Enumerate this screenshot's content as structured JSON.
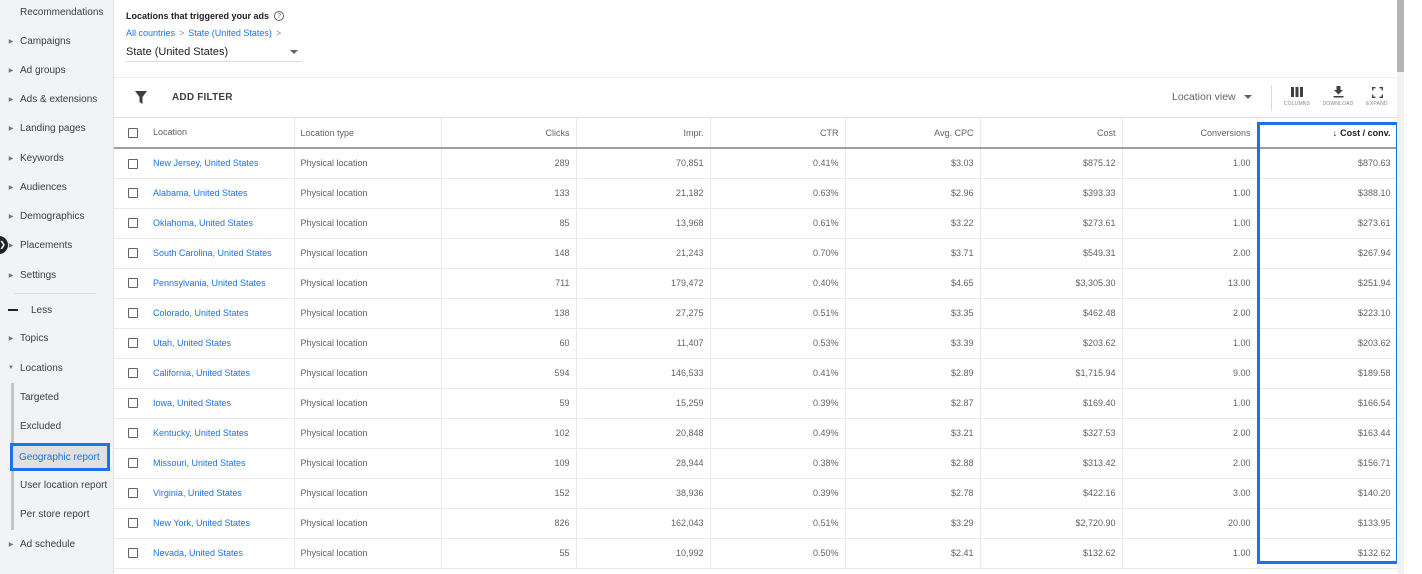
{
  "sidebar": {
    "items": [
      {
        "label": "Recommendations",
        "type": "plain"
      },
      {
        "label": "Campaigns",
        "type": "top"
      },
      {
        "label": "Ad groups",
        "type": "top"
      },
      {
        "label": "Ads & extensions",
        "type": "top"
      },
      {
        "label": "Landing pages",
        "type": "top"
      },
      {
        "label": "Keywords",
        "type": "top"
      },
      {
        "label": "Audiences",
        "type": "top"
      },
      {
        "label": "Demographics",
        "type": "top"
      },
      {
        "label": "Placements",
        "type": "top"
      },
      {
        "label": "Settings",
        "type": "top"
      }
    ],
    "less_label": "Less",
    "more_items": [
      {
        "label": "Topics"
      },
      {
        "label": "Locations"
      }
    ],
    "locations_sub": [
      {
        "label": "Targeted"
      },
      {
        "label": "Excluded"
      },
      {
        "label": "Geographic report",
        "selected": true
      },
      {
        "label": "User location report"
      },
      {
        "label": "Per store report"
      }
    ],
    "after_items": [
      {
        "label": "Ad schedule"
      }
    ]
  },
  "header": {
    "title": "Locations that triggered your ads",
    "help_icon": "help-circle-icon",
    "breadcrumb": [
      "All countries",
      "State (United States)"
    ],
    "breadcrumb_sep": ">",
    "level_select": "State (United States)"
  },
  "toolbar": {
    "add_filter": "ADD FILTER",
    "view_select": "Location view",
    "buttons": [
      {
        "label": "COLUMNS",
        "icon": "columns-icon"
      },
      {
        "label": "DOWNLOAD",
        "icon": "download-icon"
      },
      {
        "label": "EXPAND",
        "icon": "expand-icon"
      }
    ]
  },
  "table": {
    "columns": [
      "Location",
      "Location type",
      "Clicks",
      "Impr.",
      "CTR",
      "Avg. CPC",
      "Cost",
      "Conversions",
      "Cost / conv."
    ],
    "sorted_column": "Cost / conv.",
    "sort_direction": "descending",
    "highlight_color": "#1a73e8",
    "rows": [
      [
        "New Jersey, United States",
        "Physical location",
        "289",
        "70,851",
        "0.41%",
        "$3.03",
        "$875.12",
        "1.00",
        "$870.63"
      ],
      [
        "Alabama, United States",
        "Physical location",
        "133",
        "21,182",
        "0.63%",
        "$2.96",
        "$393.33",
        "1.00",
        "$388.10"
      ],
      [
        "Oklahoma, United States",
        "Physical location",
        "85",
        "13,968",
        "0.61%",
        "$3.22",
        "$273.61",
        "1.00",
        "$273.61"
      ],
      [
        "South Carolina, United States",
        "Physical location",
        "148",
        "21,243",
        "0.70%",
        "$3.71",
        "$549.31",
        "2.00",
        "$267.94"
      ],
      [
        "Pennsylvania, United States",
        "Physical location",
        "711",
        "179,472",
        "0.40%",
        "$4.65",
        "$3,305.30",
        "13.00",
        "$251.94"
      ],
      [
        "Colorado, United States",
        "Physical location",
        "138",
        "27,275",
        "0.51%",
        "$3.35",
        "$462.48",
        "2.00",
        "$223.10"
      ],
      [
        "Utah, United States",
        "Physical location",
        "60",
        "11,407",
        "0.53%",
        "$3.39",
        "$203.62",
        "1.00",
        "$203.62"
      ],
      [
        "California, United States",
        "Physical location",
        "594",
        "146,533",
        "0.41%",
        "$2.89",
        "$1,715.94",
        "9.00",
        "$189.58"
      ],
      [
        "Iowa, United States",
        "Physical location",
        "59",
        "15,259",
        "0.39%",
        "$2.87",
        "$169.40",
        "1.00",
        "$166.54"
      ],
      [
        "Kentucky, United States",
        "Physical location",
        "102",
        "20,848",
        "0.49%",
        "$3.21",
        "$327.53",
        "2.00",
        "$163.44"
      ],
      [
        "Missouri, United States",
        "Physical location",
        "109",
        "28,944",
        "0.38%",
        "$2.88",
        "$313.42",
        "2.00",
        "$156.71"
      ],
      [
        "Virginia, United States",
        "Physical location",
        "152",
        "38,936",
        "0.39%",
        "$2.78",
        "$422.16",
        "3.00",
        "$140.20"
      ],
      [
        "New York, United States",
        "Physical location",
        "826",
        "162,043",
        "0.51%",
        "$3.29",
        "$2,720.90",
        "20.00",
        "$133.95"
      ],
      [
        "Nevada, United States",
        "Physical location",
        "55",
        "10,992",
        "0.50%",
        "$2.41",
        "$132.62",
        "1.00",
        "$132.62"
      ]
    ]
  }
}
